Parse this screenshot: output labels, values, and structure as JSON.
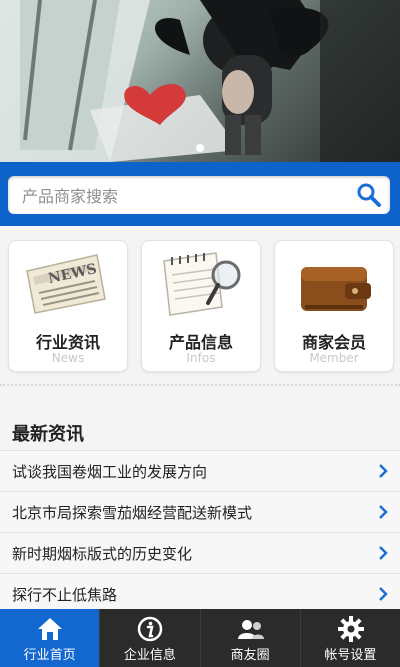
{
  "banner": {
    "slides": 1,
    "active_index": 0
  },
  "search": {
    "placeholder": "产品商家搜索"
  },
  "categories": [
    {
      "name": "行业资讯",
      "sub": "News",
      "icon": "newspaper-icon"
    },
    {
      "name": "产品信息",
      "sub": "Infos",
      "icon": "notepad-magnifier-icon"
    },
    {
      "name": "商家会员",
      "sub": "Member",
      "icon": "wallet-icon"
    }
  ],
  "news": {
    "title": "最新资讯",
    "items": [
      "试谈我国卷烟工业的发展方向",
      "北京市局探索雪茄烟经营配送新模式",
      "新时期烟标版式的历史变化",
      "探行不止低焦路"
    ]
  },
  "bottom_nav": [
    {
      "label": "行业首页",
      "icon": "home-icon",
      "active": true
    },
    {
      "label": "企业信息",
      "icon": "info-icon",
      "active": false
    },
    {
      "label": "商友圈",
      "icon": "users-icon",
      "active": false
    },
    {
      "label": "帐号设置",
      "icon": "gear-icon",
      "active": false
    }
  ],
  "colors": {
    "accent": "#0d63c9",
    "nav_bg": "#2b2b2b",
    "chevron": "#1a6fd6"
  }
}
